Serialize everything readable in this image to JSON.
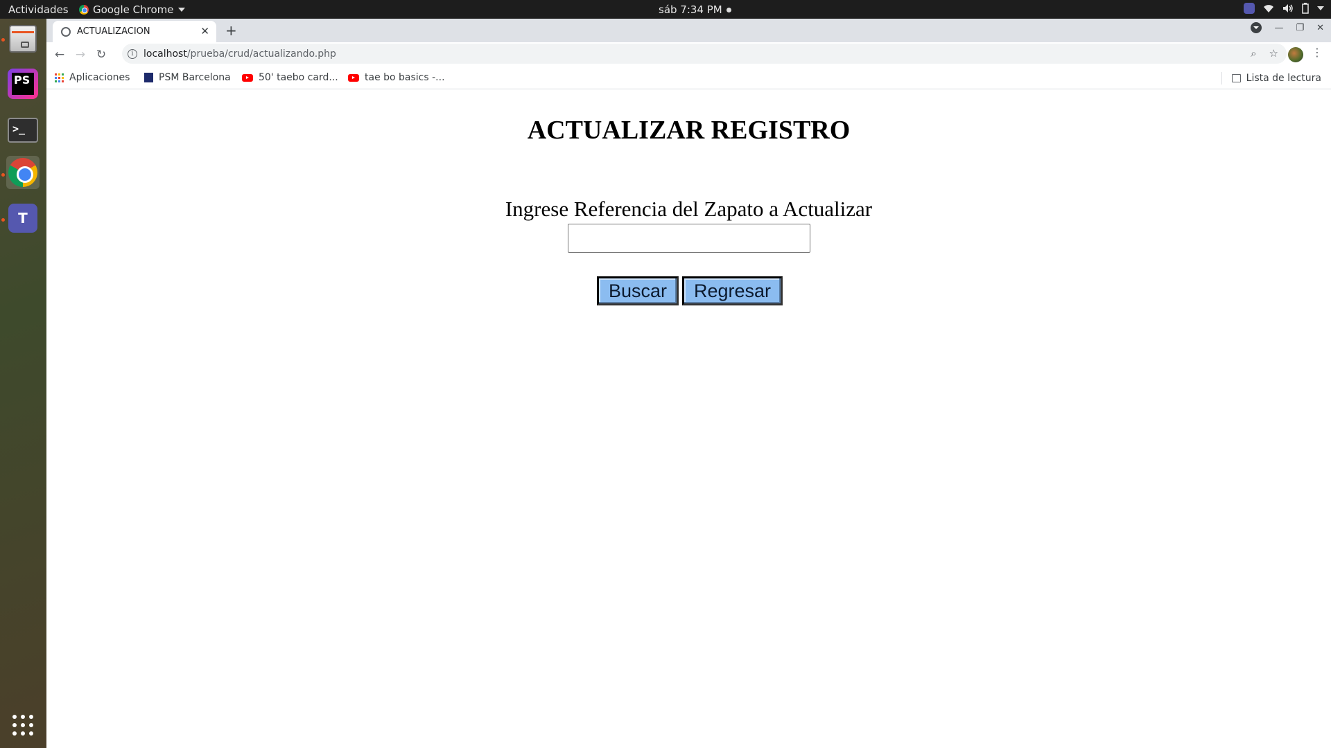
{
  "topbar": {
    "activities": "Actividades",
    "app_name": "Google Chrome",
    "clock": "sáb  7:34 PM"
  },
  "dock": {
    "items": [
      "files",
      "phpstorm",
      "terminal",
      "chrome",
      "teams",
      "show-apps"
    ]
  },
  "browser": {
    "tab_title": "ACTUALIZACION",
    "url_host": "localhost",
    "url_path": "/prueba/crud/actualizando.php",
    "bookmarks": [
      {
        "label": "Aplicaciones",
        "icon": "apps-grid-icon"
      },
      {
        "label": "PSM Barcelona",
        "icon": "psm-icon"
      },
      {
        "label": "50' taebo card...",
        "icon": "youtube-icon"
      },
      {
        "label": "tae bo basics -...",
        "icon": "youtube-icon"
      }
    ],
    "reading_list": "Lista de lectura"
  },
  "page": {
    "title": "ACTUALIZAR REGISTRO",
    "prompt": "Ingrese Referencia del Zapato a Actualizar",
    "input_value": "",
    "search_button": "Buscar",
    "back_button": "Regresar"
  },
  "colors": {
    "button_bg": "#8bbcf0",
    "accent_running": "#e95420"
  }
}
